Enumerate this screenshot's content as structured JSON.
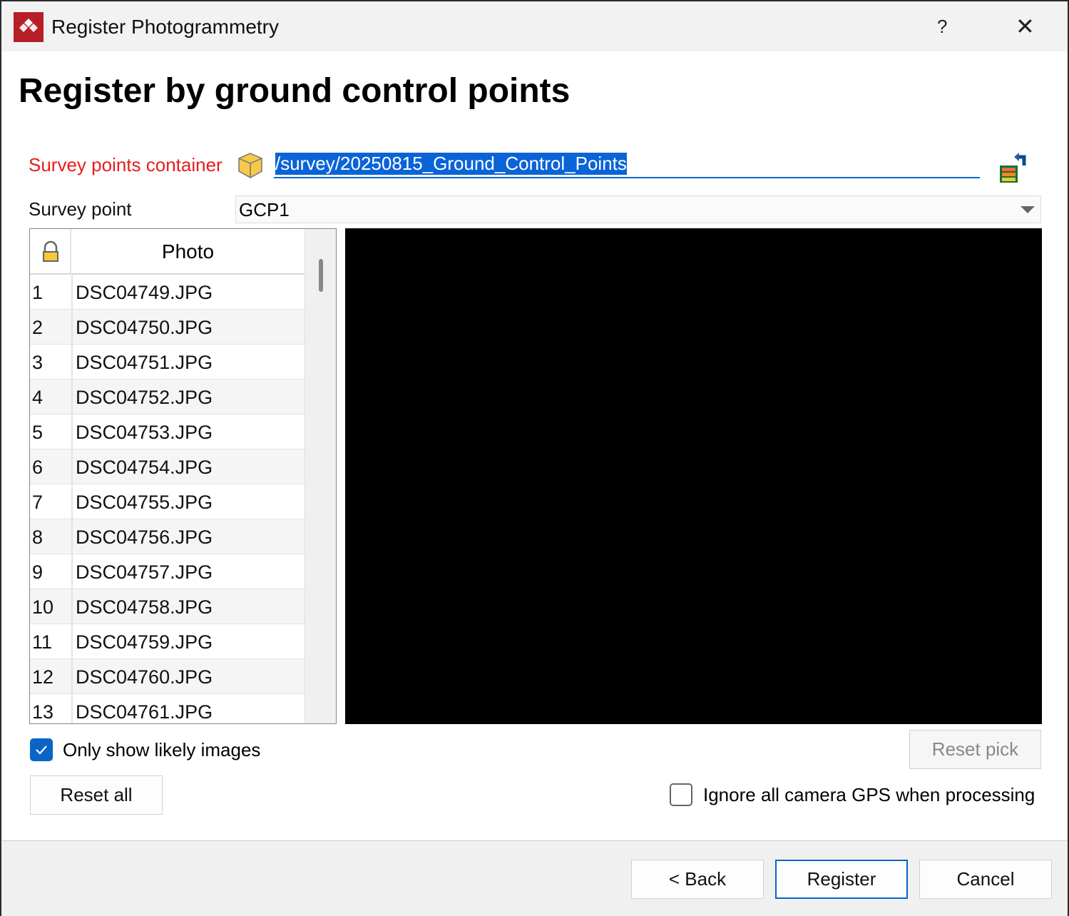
{
  "window": {
    "title": "Register Photogrammetry",
    "help": "?",
    "close": "✕"
  },
  "heading": "Register by ground control points",
  "survey_container": {
    "label": "Survey points container",
    "value": "/survey/20250815_Ground_Control_Points"
  },
  "survey_point": {
    "label": "Survey point",
    "value": "GCP1"
  },
  "table": {
    "header": "Photo",
    "rows": [
      {
        "n": "1",
        "photo": "DSC04749.JPG"
      },
      {
        "n": "2",
        "photo": "DSC04750.JPG"
      },
      {
        "n": "3",
        "photo": "DSC04751.JPG"
      },
      {
        "n": "4",
        "photo": "DSC04752.JPG"
      },
      {
        "n": "5",
        "photo": "DSC04753.JPG"
      },
      {
        "n": "6",
        "photo": "DSC04754.JPG"
      },
      {
        "n": "7",
        "photo": "DSC04755.JPG"
      },
      {
        "n": "8",
        "photo": "DSC04756.JPG"
      },
      {
        "n": "9",
        "photo": "DSC04757.JPG"
      },
      {
        "n": "10",
        "photo": "DSC04758.JPG"
      },
      {
        "n": "11",
        "photo": "DSC04759.JPG"
      },
      {
        "n": "12",
        "photo": "DSC04760.JPG"
      },
      {
        "n": "13",
        "photo": "DSC04761.JPG"
      }
    ]
  },
  "only_likely": {
    "label": "Only show likely images",
    "checked": true
  },
  "ignore_gps": {
    "label": "Ignore all camera GPS when processing",
    "checked": false
  },
  "buttons": {
    "reset_pick": "Reset pick",
    "reset_all": "Reset all",
    "back": "< Back",
    "register": "Register",
    "cancel": "Cancel"
  }
}
